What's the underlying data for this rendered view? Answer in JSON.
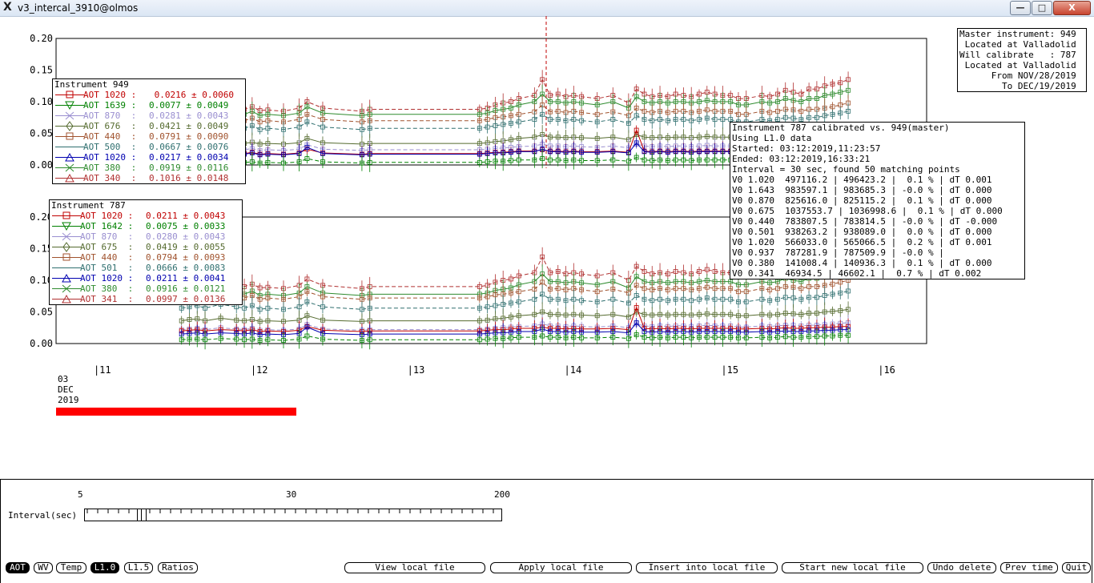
{
  "window": {
    "title": "v3_intercal_3910@olmos",
    "minimize": "—",
    "maximize": "□",
    "close": "X"
  },
  "upper_plot": {
    "y_ticks": [
      "0.20",
      "0.15",
      "0.10",
      "0.05",
      "0.00"
    ]
  },
  "lower_plot": {
    "y_ticks": [
      "0.20",
      "0.15",
      "0.10",
      "0.05",
      "0.00"
    ]
  },
  "x_axis": {
    "ticks": [
      "|11",
      "|12",
      "|13",
      "|14",
      "|15",
      "|16"
    ],
    "date_day": "03",
    "date_month": "DEC",
    "date_year": "2019"
  },
  "legend_949": {
    "title": "Instrument 949",
    "rows": [
      {
        "label": "AOT 1020 :",
        "value": " 0.0216 ± 0.0060",
        "color": "#c00000",
        "marker": "square"
      },
      {
        "label": "AOT 1639 :",
        "value": "0.0077 ± 0.0049",
        "color": "#008000",
        "marker": "down"
      },
      {
        "label": "AOT 870  :",
        "value": "0.0281 ± 0.0043",
        "color": "#9a8fd0",
        "marker": "x"
      },
      {
        "label": "AOT 676  :",
        "value": "0.0421 ± 0.0049",
        "color": "#556b2f",
        "marker": "diamond"
      },
      {
        "label": "AOT 440  :",
        "value": "0.0791 ± 0.0090",
        "color": "#a0522d",
        "marker": "square"
      },
      {
        "label": "AOT 500  :",
        "value": "0.0667 ± 0.0076",
        "color": "#2f6f6f",
        "marker": "line"
      },
      {
        "label": "AOT 1020 :",
        "value": "0.0217 ± 0.0034",
        "color": "#0000b0",
        "marker": "up"
      },
      {
        "label": "AOT 380  :",
        "value": "0.0919 ± 0.0116",
        "color": "#2e8b2e",
        "marker": "x"
      },
      {
        "label": "AOT 340  :",
        "value": "0.1016 ± 0.0148",
        "color": "#b03030",
        "marker": "up"
      }
    ]
  },
  "legend_787": {
    "title": "Instrument 787",
    "rows": [
      {
        "label": "AOT 1020 :",
        "value": "0.0211 ± 0.0043",
        "color": "#c00000",
        "marker": "square"
      },
      {
        "label": "AOT 1642 :",
        "value": "0.0075 ± 0.0033",
        "color": "#008000",
        "marker": "down"
      },
      {
        "label": "AOT 870  :",
        "value": "0.0280 ± 0.0043",
        "color": "#9a8fd0",
        "marker": "x"
      },
      {
        "label": "AOT 675  :",
        "value": "0.0419 ± 0.0055",
        "color": "#556b2f",
        "marker": "diamond"
      },
      {
        "label": "AOT 440  :",
        "value": "0.0794 ± 0.0093",
        "color": "#a0522d",
        "marker": "square"
      },
      {
        "label": "AOT 501  :",
        "value": "0.0666 ± 0.0083",
        "color": "#2f6f6f",
        "marker": "line"
      },
      {
        "label": "AOT 1020 :",
        "value": "0.0211 ± 0.0041",
        "color": "#0000b0",
        "marker": "up"
      },
      {
        "label": "AOT 380  :",
        "value": "0.0916 ± 0.0121",
        "color": "#2e8b2e",
        "marker": "x"
      },
      {
        "label": "AOT 341  :",
        "value": "0.0997 ± 0.0136",
        "color": "#b03030",
        "marker": "up"
      }
    ]
  },
  "master_box": {
    "lines": [
      "Master instrument: 949",
      " Located at Valladolid",
      "Will calibrate   : 787",
      " Located at Valladolid",
      "      From NOV/28/2019",
      "        To DEC/19/2019"
    ]
  },
  "calib_box": {
    "lines": [
      "Instrument 787 calibrated vs. 949(master)",
      "Using L1.0 data",
      "Started: 03:12:2019,11:23:57",
      "Ended: 03:12:2019,16:33:21",
      "Interval = 30 sec, found 50 matching points",
      "V0 1.020  497116.2 | 496423.2 |  0.1 % | dT 0.001",
      "V0 1.643  983597.1 | 983685.3 | -0.0 % | dT 0.000",
      "V0 0.870  825616.0 | 825115.2 |  0.1 % | dT 0.000",
      "V0 0.675  1037553.7 | 1036998.6 |  0.1 % | dT 0.000",
      "V0 0.440  783807.5 | 783814.5 | -0.0 % | dT -0.000",
      "V0 0.501  938263.2 | 938089.0 |  0.0 % | dT 0.000",
      "V0 1.020  566033.0 | 565066.5 |  0.2 % | dT 0.001",
      "V0 0.937  787281.9 | 787509.9 | -0.0 % |",
      "V0 0.380  141008.4 | 140936.3 |  0.1 % | dT 0.000",
      "V0 0.341  46934.5 | 46602.1 |  0.7 % | dT 0.002"
    ]
  },
  "interval_slider": {
    "label": "Interval(sec)",
    "min_label": "5",
    "mid_label": "30",
    "max_label": "200",
    "value": 30
  },
  "bottom_buttons": {
    "aot": "AOT",
    "wv": "WV",
    "temp": "Temp",
    "l10": "L1.0",
    "l15": "L1.5",
    "ratios": "Ratios",
    "view_local": "View local file",
    "apply_local": "Apply local file",
    "insert_local": "Insert into local file",
    "start_new": "Start new local file",
    "undo_delete": "Undo delete",
    "prev_time": "Prev time",
    "quit": "Quit"
  },
  "chart_data": {
    "type": "line",
    "x": [
      11.55,
      11.6,
      11.65,
      11.7,
      11.8,
      11.9,
      11.95,
      12.0,
      12.05,
      12.1,
      12.2,
      12.3,
      12.35,
      12.45,
      12.7,
      12.75,
      13.45,
      13.5,
      13.55,
      13.6,
      13.65,
      13.7,
      13.8,
      13.85,
      13.9,
      13.95,
      14.0,
      14.05,
      14.1,
      14.2,
      14.3,
      14.4,
      14.45,
      14.5,
      14.55,
      14.6,
      14.65,
      14.7,
      14.75,
      14.8,
      14.85,
      14.9,
      14.95,
      15.0,
      15.05,
      15.1,
      15.15,
      15.25,
      15.3,
      15.35,
      15.4,
      15.45,
      15.5,
      15.55,
      15.6,
      15.65,
      15.7,
      15.75,
      15.8
    ],
    "xlabel": "",
    "ylabel": "",
    "ylim": [
      0,
      0.2
    ],
    "xlim": [
      10.75,
      16.3
    ],
    "series": [
      {
        "name": "AOT 340",
        "color": "#b03030",
        "dashed": true,
        "y": [
          0.085,
          0.09,
          0.092,
          0.088,
          0.095,
          0.09,
          0.088,
          0.092,
          0.086,
          0.087,
          0.085,
          0.09,
          0.1,
          0.09,
          0.085,
          0.088,
          0.088,
          0.09,
          0.095,
          0.098,
          0.1,
          0.105,
          0.11,
          0.135,
          0.11,
          0.112,
          0.108,
          0.11,
          0.108,
          0.105,
          0.11,
          0.098,
          0.12,
          0.112,
          0.108,
          0.11,
          0.108,
          0.112,
          0.11,
          0.108,
          0.112,
          0.115,
          0.112,
          0.11,
          0.11,
          0.105,
          0.105,
          0.11,
          0.108,
          0.112,
          0.118,
          0.115,
          0.112,
          0.12,
          0.12,
          0.125,
          0.128,
          0.13,
          0.135
        ]
      },
      {
        "name": "AOT 380",
        "color": "#2e8b2e",
        "dashed": false,
        "y": [
          0.078,
          0.082,
          0.085,
          0.08,
          0.088,
          0.082,
          0.08,
          0.085,
          0.078,
          0.08,
          0.078,
          0.082,
          0.092,
          0.082,
          0.078,
          0.08,
          0.08,
          0.082,
          0.086,
          0.088,
          0.09,
          0.095,
          0.1,
          0.112,
          0.1,
          0.1,
          0.098,
          0.1,
          0.098,
          0.095,
          0.1,
          0.09,
          0.108,
          0.1,
          0.098,
          0.1,
          0.098,
          0.1,
          0.1,
          0.098,
          0.1,
          0.102,
          0.1,
          0.1,
          0.1,
          0.095,
          0.095,
          0.1,
          0.098,
          0.1,
          0.105,
          0.102,
          0.1,
          0.105,
          0.105,
          0.11,
          0.112,
          0.115,
          0.118
        ]
      },
      {
        "name": "AOT 440",
        "color": "#a0522d",
        "dashed": true,
        "y": [
          0.07,
          0.072,
          0.074,
          0.07,
          0.076,
          0.072,
          0.07,
          0.074,
          0.068,
          0.07,
          0.068,
          0.072,
          0.08,
          0.072,
          0.068,
          0.07,
          0.07,
          0.072,
          0.075,
          0.076,
          0.078,
          0.08,
          0.084,
          0.095,
          0.084,
          0.085,
          0.083,
          0.085,
          0.083,
          0.08,
          0.084,
          0.078,
          0.09,
          0.085,
          0.083,
          0.085,
          0.083,
          0.085,
          0.085,
          0.083,
          0.085,
          0.087,
          0.085,
          0.085,
          0.085,
          0.08,
          0.08,
          0.085,
          0.083,
          0.085,
          0.088,
          0.087,
          0.085,
          0.088,
          0.088,
          0.09,
          0.092,
          0.095,
          0.098
        ]
      },
      {
        "name": "AOT 500",
        "color": "#2f6f6f",
        "dashed": true,
        "y": [
          0.058,
          0.06,
          0.062,
          0.058,
          0.064,
          0.06,
          0.058,
          0.062,
          0.056,
          0.058,
          0.056,
          0.06,
          0.068,
          0.06,
          0.056,
          0.058,
          0.058,
          0.06,
          0.062,
          0.064,
          0.066,
          0.068,
          0.072,
          0.08,
          0.072,
          0.072,
          0.07,
          0.072,
          0.07,
          0.068,
          0.072,
          0.066,
          0.078,
          0.072,
          0.07,
          0.072,
          0.07,
          0.072,
          0.072,
          0.07,
          0.072,
          0.074,
          0.072,
          0.072,
          0.072,
          0.068,
          0.068,
          0.072,
          0.07,
          0.072,
          0.075,
          0.074,
          0.072,
          0.075,
          0.075,
          0.078,
          0.08,
          0.082,
          0.085
        ]
      },
      {
        "name": "AOT 676",
        "color": "#556b2f",
        "dashed": false,
        "y": [
          0.034,
          0.036,
          0.037,
          0.034,
          0.038,
          0.035,
          0.034,
          0.036,
          0.033,
          0.034,
          0.033,
          0.035,
          0.042,
          0.035,
          0.033,
          0.034,
          0.034,
          0.035,
          0.037,
          0.038,
          0.04,
          0.042,
          0.044,
          0.048,
          0.044,
          0.044,
          0.043,
          0.044,
          0.043,
          0.042,
          0.044,
          0.04,
          0.048,
          0.044,
          0.043,
          0.044,
          0.043,
          0.044,
          0.044,
          0.043,
          0.044,
          0.045,
          0.044,
          0.044,
          0.044,
          0.042,
          0.042,
          0.044,
          0.043,
          0.044,
          0.046,
          0.045,
          0.044,
          0.046,
          0.046,
          0.048,
          0.049,
          0.05,
          0.052
        ]
      },
      {
        "name": "AOT 870",
        "color": "#9a8fd0",
        "dashed": true,
        "y": [
          0.024,
          0.025,
          0.026,
          0.024,
          0.027,
          0.025,
          0.024,
          0.026,
          0.023,
          0.024,
          0.023,
          0.025,
          0.032,
          0.025,
          0.023,
          0.024,
          0.024,
          0.025,
          0.026,
          0.027,
          0.028,
          0.029,
          0.03,
          0.033,
          0.03,
          0.03,
          0.029,
          0.03,
          0.029,
          0.028,
          0.03,
          0.027,
          0.033,
          0.03,
          0.029,
          0.03,
          0.029,
          0.03,
          0.03,
          0.029,
          0.03,
          0.031,
          0.03,
          0.03,
          0.03,
          0.028,
          0.028,
          0.03,
          0.029,
          0.03,
          0.031,
          0.031,
          0.03,
          0.031,
          0.031,
          0.032,
          0.033,
          0.034,
          0.035
        ]
      },
      {
        "name": "AOT 1020",
        "color": "#c00000",
        "dashed": false,
        "y": [
          0.018,
          0.019,
          0.02,
          0.018,
          0.02,
          0.019,
          0.018,
          0.02,
          0.017,
          0.018,
          0.017,
          0.019,
          0.025,
          0.019,
          0.017,
          0.018,
          0.018,
          0.019,
          0.02,
          0.02,
          0.021,
          0.022,
          0.022,
          0.024,
          0.022,
          0.022,
          0.021,
          0.022,
          0.021,
          0.021,
          0.022,
          0.02,
          0.055,
          0.022,
          0.021,
          0.022,
          0.021,
          0.022,
          0.022,
          0.021,
          0.022,
          0.022,
          0.022,
          0.022,
          0.022,
          0.021,
          0.021,
          0.022,
          0.021,
          0.022,
          0.023,
          0.022,
          0.022,
          0.023,
          0.023,
          0.024,
          0.024,
          0.025,
          0.025
        ]
      },
      {
        "name": "AOT 1020 ",
        "color": "#0000b0",
        "dashed": false,
        "y": [
          0.017,
          0.018,
          0.019,
          0.017,
          0.019,
          0.018,
          0.017,
          0.019,
          0.016,
          0.017,
          0.016,
          0.018,
          0.028,
          0.018,
          0.016,
          0.017,
          0.017,
          0.018,
          0.019,
          0.019,
          0.02,
          0.021,
          0.021,
          0.025,
          0.021,
          0.021,
          0.02,
          0.021,
          0.02,
          0.02,
          0.021,
          0.019,
          0.035,
          0.021,
          0.02,
          0.021,
          0.02,
          0.021,
          0.021,
          0.02,
          0.021,
          0.021,
          0.021,
          0.021,
          0.021,
          0.02,
          0.02,
          0.021,
          0.02,
          0.021,
          0.022,
          0.021,
          0.021,
          0.022,
          0.022,
          0.023,
          0.023,
          0.024,
          0.024
        ]
      },
      {
        "name": "AOT 1639",
        "color": "#008000",
        "dashed": true,
        "y": [
          0.004,
          0.005,
          0.005,
          0.004,
          0.006,
          0.005,
          0.004,
          0.005,
          0.003,
          0.004,
          0.003,
          0.005,
          0.01,
          0.005,
          0.003,
          0.004,
          0.004,
          0.005,
          0.006,
          0.006,
          0.007,
          0.008,
          0.008,
          0.01,
          0.008,
          0.008,
          0.007,
          0.008,
          0.007,
          0.007,
          0.008,
          0.006,
          0.012,
          0.008,
          0.007,
          0.008,
          0.007,
          0.008,
          0.008,
          0.007,
          0.008,
          0.008,
          0.008,
          0.008,
          0.008,
          0.007,
          0.007,
          0.008,
          0.007,
          0.008,
          0.009,
          0.008,
          0.008,
          0.009,
          0.009,
          0.01,
          0.01,
          0.011,
          0.011
        ]
      }
    ]
  }
}
